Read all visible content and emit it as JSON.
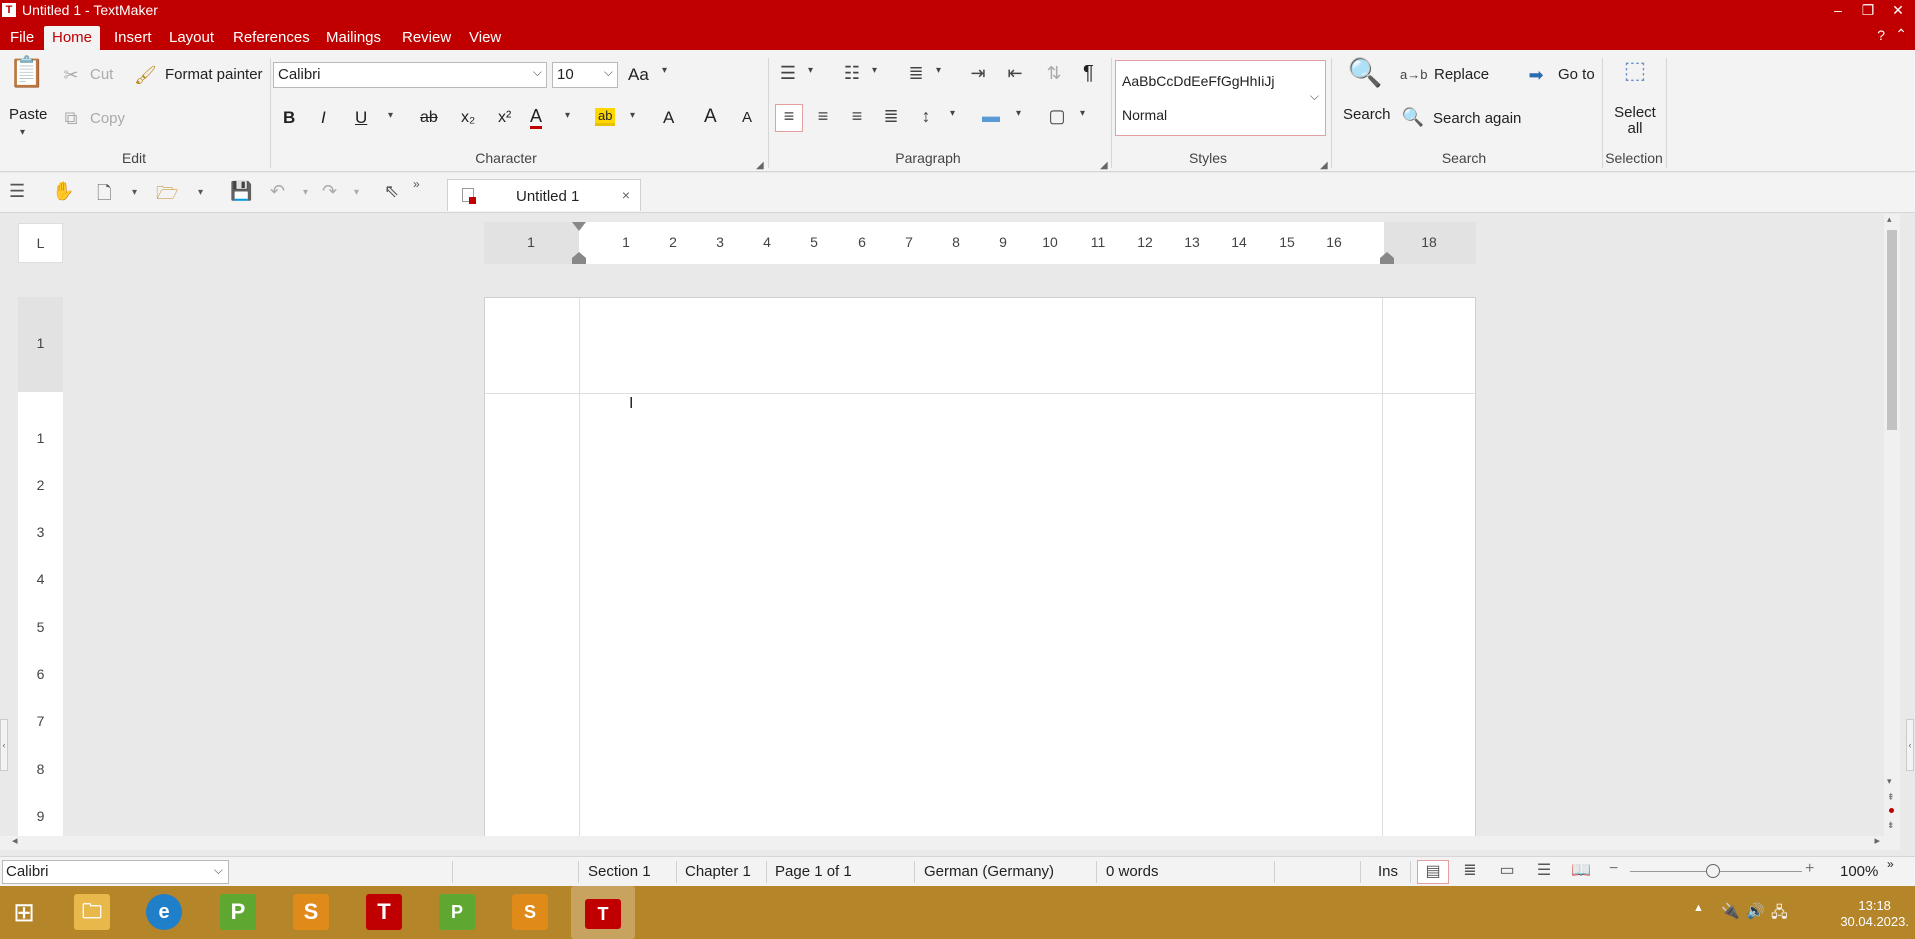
{
  "window": {
    "title": "Untitled 1 - TextMaker",
    "app_icon": "T",
    "controls": [
      "–",
      "❐",
      "✕"
    ]
  },
  "menu": {
    "items": [
      "File",
      "Home",
      "Insert",
      "Layout",
      "References",
      "Mailings",
      "Review",
      "View"
    ],
    "active": "Home",
    "help": "?",
    "collapse": "⌃"
  },
  "ribbon": {
    "edit": {
      "paste": "Paste",
      "cut": "Cut",
      "copy": "Copy",
      "format_painter": "Format painter",
      "label": "Edit"
    },
    "character": {
      "font": "Calibri",
      "size": "10",
      "label": "Character",
      "bold": "B",
      "italic": "I",
      "underline": "U",
      "strike": "ab",
      "subscript": "x₂",
      "superscript": "x²",
      "font_color": "A",
      "highlight": "ab",
      "clear_format": "A",
      "grow": "A",
      "shrink": "A",
      "case": "Aa"
    },
    "paragraph": {
      "label": "Paragraph",
      "pilcrow": "¶"
    },
    "styles": {
      "preview": "AaBbCcDdEeFfGgHhIiJj",
      "current": "Normal",
      "label": "Styles"
    },
    "search": {
      "search": "Search",
      "replace": "Replace",
      "goto": "Go to",
      "search_again": "Search again",
      "label": "Search"
    },
    "selection": {
      "select_line1": "Select",
      "select_line2": "all",
      "label": "Selection"
    }
  },
  "document_tab": {
    "title": "Untitled 1",
    "close": "×"
  },
  "ruler": {
    "corner": "L",
    "h_ticks": [
      "1",
      "1",
      "2",
      "3",
      "4",
      "5",
      "6",
      "7",
      "8",
      "9",
      "10",
      "11",
      "12",
      "13",
      "14",
      "15",
      "16",
      "18"
    ],
    "v_ticks": [
      "1",
      "1",
      "2",
      "3",
      "4",
      "5",
      "6",
      "7",
      "8",
      "9"
    ]
  },
  "status": {
    "font": "Calibri",
    "section": "Section 1",
    "chapter": "Chapter 1",
    "page": "Page 1 of 1",
    "language": "German (Germany)",
    "words": "0 words",
    "mode": "Ins",
    "zoom": "100%",
    "zoom_minus": "−",
    "zoom_plus": "+"
  },
  "taskbar": {
    "apps": [
      "windows-start",
      "file-explorer",
      "edge",
      "planmaker",
      "presentations",
      "textmaker",
      "planmaker-2",
      "presentations-2",
      "textmaker-active"
    ],
    "time": "13:18",
    "date": "30.04.2023."
  },
  "colors": {
    "accent": "#c00000",
    "taskbar": "#b5852a"
  }
}
